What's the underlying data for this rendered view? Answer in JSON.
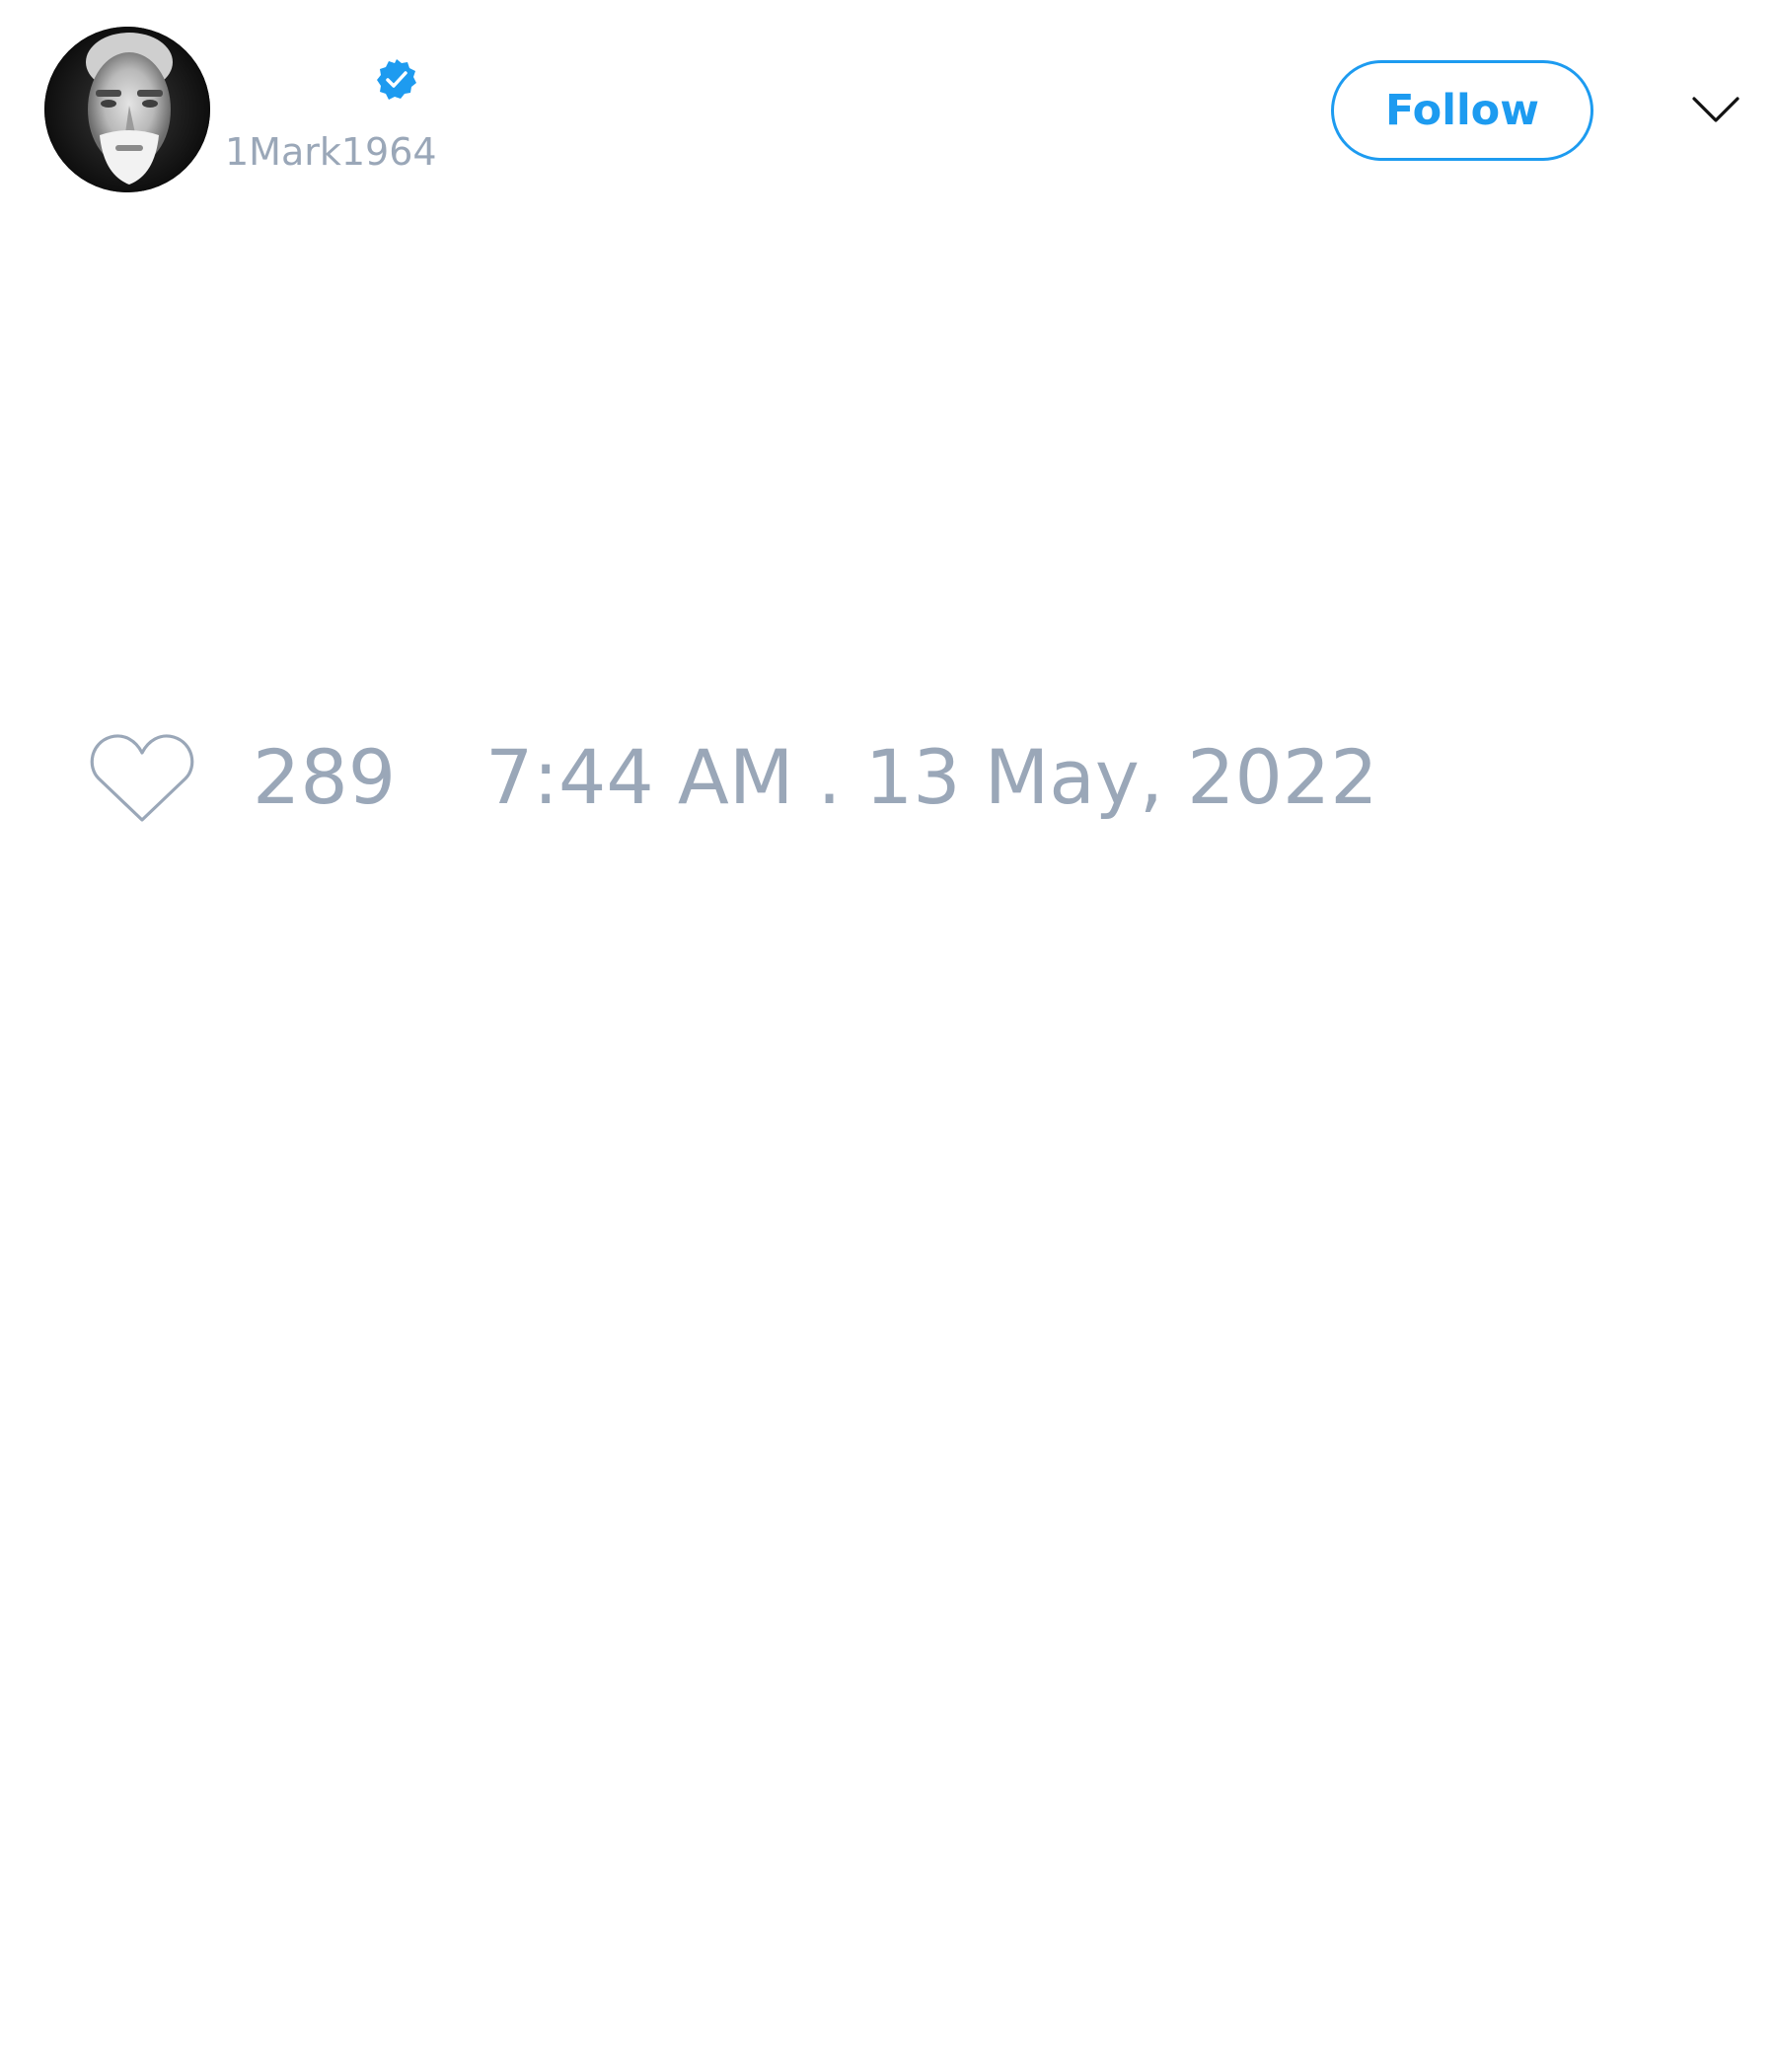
{
  "author": {
    "display_name": "",
    "handle": "1Mark1964",
    "verified": true,
    "avatar_icon": "person-avatar"
  },
  "header": {
    "follow_label": "Follow",
    "menu_icon": "chevron-down-icon"
  },
  "tweet": {
    "like_icon": "heart-outline-icon",
    "like_count": "289",
    "timestamp": "7:44 AM . 13 May, 2022"
  },
  "colors": {
    "accent": "#1d9bf0",
    "muted_text": "#9aa7b8",
    "background": "#ffffff"
  }
}
